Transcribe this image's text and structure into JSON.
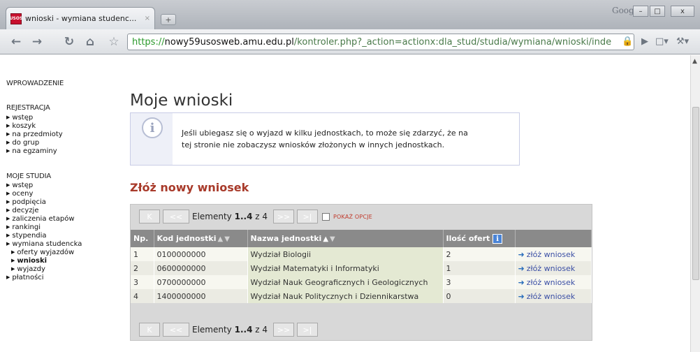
{
  "browser": {
    "tab_title": "wnioski - wymiana studenc...",
    "tab_close": "×",
    "new_tab": "+",
    "favicon_text": "USOS",
    "brand": "Google",
    "win_min": "–",
    "win_max": "□",
    "win_close": "x",
    "url_scheme": "https://",
    "url_host": "nowy59usosweb.amu.edu.pl",
    "url_path": "/kontroler.php?_action=actionx:dla_stud/studia/wymiana/wnioski/inde"
  },
  "sidebar": {
    "sections": [
      {
        "title": "WPROWADZENIE"
      },
      {
        "title": "REJESTRACJA",
        "items": [
          "wstęp",
          "koszyk",
          "na przedmioty",
          "do grup",
          "na egzaminy"
        ]
      },
      {
        "title": "MOJE STUDIA",
        "items": [
          "wstęp",
          "oceny",
          "podpięcia",
          "decyzje",
          "zaliczenia etapów",
          "rankingi",
          "stypendia",
          "wymiana studencka"
        ],
        "subitems": [
          "oferty wyjazdów",
          "wnioski",
          "wyjazdy"
        ],
        "after": [
          "płatności"
        ]
      }
    ]
  },
  "main": {
    "title": "Moje wnioski",
    "info_icon": "i",
    "info_line1": "Jeśli ubiegasz się o wyjazd w kilku jednostkach, to może się zdarzyć, że na",
    "info_line2": "tej stronie nie zobaczysz wniosków złożonych w innych jednostkach.",
    "section_title": "Złóż nowy wniosek",
    "pager": {
      "first": "K",
      "prev": "<<",
      "next": ">>",
      "last": ">|",
      "label": "Elementy ",
      "range": "1..4",
      "of": " z 4",
      "options": "POKAŻ OPCJE"
    },
    "table": {
      "headers": {
        "np": "Np.",
        "kod": "Kod jednostki",
        "nazwa": "Nazwa jednostki",
        "ilosc": "Ilość ofert",
        "info": "i"
      },
      "rows": [
        {
          "np": "1",
          "kod": "0100000000",
          "nazwa": "Wydział Biologii",
          "ilosc": "2",
          "action": "złóż wniosek"
        },
        {
          "np": "2",
          "kod": "0600000000",
          "nazwa": "Wydział Matematyki i Informatyki",
          "ilosc": "1",
          "action": "złóż wniosek"
        },
        {
          "np": "3",
          "kod": "0700000000",
          "nazwa": "Wydział Nauk Geograficznych i Geologicznych",
          "ilosc": "3",
          "action": "złóż wniosek"
        },
        {
          "np": "4",
          "kod": "1400000000",
          "nazwa": "Wydział Nauk Politycznych i Dziennikarstwa",
          "ilosc": "0",
          "action": "złóż wniosek"
        }
      ]
    }
  }
}
